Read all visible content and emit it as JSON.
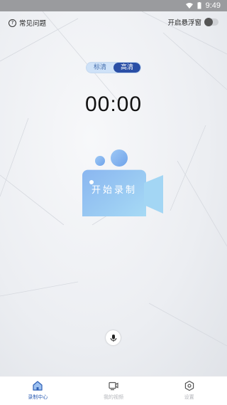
{
  "status_bar": {
    "time": "9:49",
    "icons": [
      "wifi-icon",
      "battery-icon"
    ]
  },
  "header": {
    "faq_label": "常见问题",
    "faq_icon": "question-circle-icon",
    "float_window_label": "开启悬浮窗",
    "float_window_enabled": false
  },
  "quality": {
    "options": [
      "标清",
      "高清"
    ],
    "selected": "高清"
  },
  "timer": "00:00",
  "record_button": {
    "label": "开始录制",
    "icon": "video-camera-icon"
  },
  "mic_icon": "microphone-icon",
  "nav": {
    "tabs": [
      {
        "label": "录制中心",
        "icon": "home-icon",
        "active": true
      },
      {
        "label": "我的视频",
        "icon": "video-icon",
        "active": false
      },
      {
        "label": "设置",
        "icon": "settings-icon",
        "active": false
      }
    ]
  },
  "colors": {
    "status_bar": "#9a9b9e",
    "accent": "#2a4fa6",
    "nav_active": "#2f5fb4",
    "camera_gradient_start": "#8ab6f0",
    "camera_gradient_end": "#a8dcf5"
  }
}
